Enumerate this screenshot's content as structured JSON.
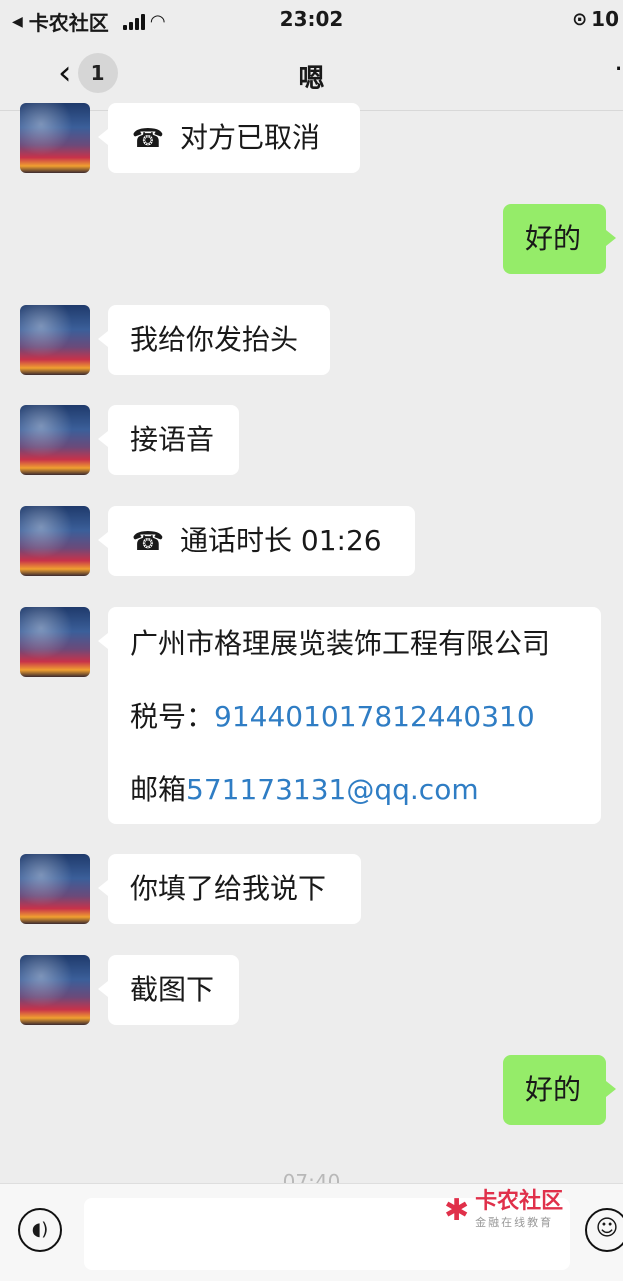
{
  "status_bar": {
    "carrier": "卡农社区",
    "time": "23:02",
    "battery": "10"
  },
  "nav": {
    "back_count": "1",
    "title": "嗯"
  },
  "messages": [
    {
      "side": "in",
      "type": "call",
      "text": "对方已取消"
    },
    {
      "side": "out",
      "type": "text",
      "text": "好的"
    },
    {
      "side": "in",
      "type": "text",
      "text": "我给你发抬头"
    },
    {
      "side": "in",
      "type": "text",
      "text": "接语音"
    },
    {
      "side": "in",
      "type": "call",
      "text": "通话时长 01:26"
    },
    {
      "side": "in",
      "type": "card",
      "company": "广州市格理展览装饰工程有限公司",
      "tax_label": "税号：",
      "tax_number": "914401017812440310",
      "email_label": "邮箱",
      "email": "571173131@qq.com"
    },
    {
      "side": "in",
      "type": "text",
      "text": "你填了给我说下"
    },
    {
      "side": "in",
      "type": "text",
      "text": "截图下"
    },
    {
      "side": "out",
      "type": "text",
      "text": "好的"
    }
  ],
  "timestamp": "07:40",
  "input_bar": {
    "placeholder": ""
  },
  "watermark": {
    "title": "卡农社区",
    "subtitle": "金融在线教育"
  },
  "icons": {
    "back": "chevron-left-icon",
    "voice": "voice-icon",
    "emoji": "emoji-icon",
    "call": "phone-hangup-icon"
  },
  "colors": {
    "background": "#ededed",
    "outgoing_bubble": "#95ec69",
    "incoming_bubble": "#ffffff",
    "link": "#2f7dc4"
  }
}
